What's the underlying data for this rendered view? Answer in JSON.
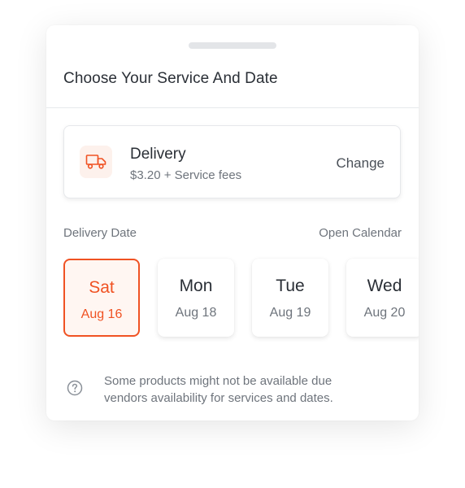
{
  "sheet": {
    "title": "Choose Your Service And Date"
  },
  "service": {
    "icon": "truck-icon",
    "name": "Delivery",
    "fee": "$3.20 + Service fees",
    "change_label": "Change"
  },
  "date_section": {
    "label": "Delivery Date",
    "open_calendar_label": "Open Calendar",
    "dates": [
      {
        "day": "Sat",
        "date": "Aug 16",
        "selected": true
      },
      {
        "day": "Mon",
        "date": "Aug 18",
        "selected": false
      },
      {
        "day": "Tue",
        "date": "Aug 19",
        "selected": false
      },
      {
        "day": "Wed",
        "date": "Aug 20",
        "selected": false
      }
    ]
  },
  "note": {
    "icon": "question-circle-icon",
    "text": "Some products might not be available due vendors availability for services and dates."
  },
  "colors": {
    "accent": "#f05223",
    "accent_bg": "#fff6f2",
    "text_primary": "#2a2f36",
    "text_secondary": "#6e747c"
  }
}
